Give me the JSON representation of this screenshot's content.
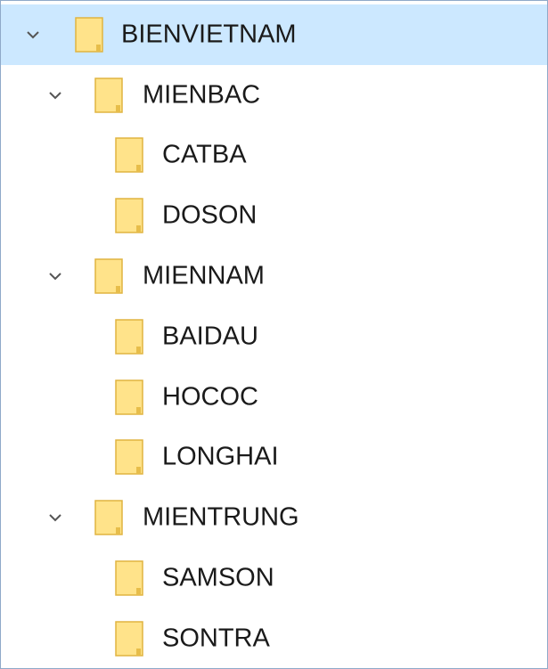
{
  "tree": {
    "root": {
      "label": "BIENVIETNAM",
      "expanded": true,
      "selected": true,
      "icon": "folder-icon"
    },
    "groups": [
      {
        "label": "MIENBAC",
        "expanded": true,
        "icon": "folder-icon",
        "children": [
          {
            "label": "CATBA"
          },
          {
            "label": "DOSON"
          }
        ]
      },
      {
        "label": "MIENNAM",
        "expanded": true,
        "icon": "folder-icon",
        "children": [
          {
            "label": "BAIDAU"
          },
          {
            "label": "HOCOC"
          },
          {
            "label": "LONGHAI"
          }
        ]
      },
      {
        "label": "MIENTRUNG",
        "expanded": true,
        "icon": "folder-icon",
        "children": [
          {
            "label": "SAMSON"
          },
          {
            "label": "SONTRA"
          }
        ]
      }
    ]
  },
  "colors": {
    "selection": "#cce8ff",
    "folder_fill": "#ffe38a",
    "folder_outline": "#e0b440",
    "chevron": "#555555"
  }
}
